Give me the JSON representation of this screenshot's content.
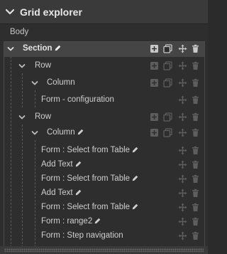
{
  "header": {
    "title": "Grid explorer"
  },
  "body_label": "Body",
  "tree": [
    {
      "label": "Section",
      "level": 0,
      "chevron": true,
      "pencil": true,
      "actions": [
        "add",
        "copy",
        "move",
        "delete"
      ],
      "selected": true
    },
    {
      "label": "Row",
      "level": 1,
      "chevron": true,
      "pencil": false,
      "actions": [
        "add",
        "copy",
        "move",
        "delete"
      ]
    },
    {
      "label": "Column",
      "level": 2,
      "chevron": true,
      "pencil": false,
      "actions": [
        "add",
        "copy",
        "move",
        "delete"
      ]
    },
    {
      "label": "Form - configuration",
      "level": 3,
      "chevron": false,
      "pencil": false,
      "actions": [
        "move",
        "delete"
      ]
    },
    {
      "label": "Row",
      "level": 1,
      "chevron": true,
      "pencil": false,
      "actions": [
        "add",
        "copy",
        "move",
        "delete"
      ]
    },
    {
      "label": "Column",
      "level": 2,
      "chevron": true,
      "pencil": true,
      "actions": [
        "add",
        "copy",
        "move",
        "delete"
      ]
    },
    {
      "label": "Form : Select from Table",
      "level": 3,
      "chevron": false,
      "pencil": true,
      "actions": [
        "move",
        "delete"
      ]
    },
    {
      "label": "Add Text",
      "level": 3,
      "chevron": false,
      "pencil": true,
      "actions": [
        "move",
        "delete"
      ]
    },
    {
      "label": "Form : Select from Table",
      "level": 3,
      "chevron": false,
      "pencil": true,
      "actions": [
        "move",
        "delete"
      ]
    },
    {
      "label": "Add Text",
      "level": 3,
      "chevron": false,
      "pencil": true,
      "actions": [
        "move",
        "delete"
      ]
    },
    {
      "label": "Form : Select from Table",
      "level": 3,
      "chevron": false,
      "pencil": true,
      "actions": [
        "move",
        "delete"
      ]
    },
    {
      "label": "Form : range2",
      "level": 3,
      "chevron": false,
      "pencil": true,
      "actions": [
        "move",
        "delete"
      ]
    },
    {
      "label": "Form : Step navigation",
      "level": 3,
      "chevron": false,
      "pencil": false,
      "actions": [
        "move",
        "delete"
      ]
    }
  ],
  "colors": {
    "background": "#2e2e2e",
    "header": "#3a3a3a",
    "selected_row": "#454545",
    "text": "#cfcfcf",
    "icon_active": "#c8c8c8",
    "icon_dim": "#5e5e5e"
  },
  "icons": {
    "header_chevron": "chevron-down-icon",
    "edit": "pencil-icon",
    "add": "add-icon",
    "copy": "copy-icon",
    "move": "move-icon",
    "delete": "trash-icon"
  }
}
